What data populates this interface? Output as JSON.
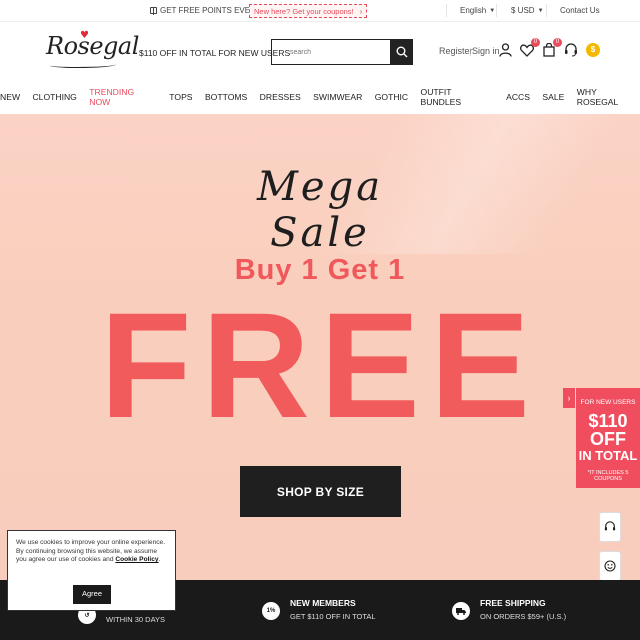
{
  "topbar": {
    "points_text": "GET FREE POINTS EVERYDAY",
    "promo_text": "New here? Get your coupons!",
    "promo_arrow": "›",
    "language": "English",
    "currency": "$ USD",
    "contact": "Contact Us"
  },
  "header": {
    "logo": "Rosegal",
    "tagline": "$110 OFF IN TOTAL FOR NEW USERS",
    "search_placeholder": "search",
    "register": "Register",
    "sign_in": "Sign in",
    "wishlist_count": "0",
    "cart_count": "0",
    "coin_symbol": "$"
  },
  "nav": [
    "NEW",
    "CLOTHING",
    "TRENDING NOW",
    "TOPS",
    "BOTTOMS",
    "DRESSES",
    "SWIMWEAR",
    "GOTHIC",
    "OUTFIT BUNDLES",
    "ACCS",
    "SALE",
    "WHY ROSEGAL"
  ],
  "hero": {
    "script_title": "Mega Sale",
    "subtitle": "Buy 1 Get 1",
    "headline": "FREE",
    "cta": "SHOP BY SIZE"
  },
  "new_user_panel": {
    "tab_arrow": "›",
    "label": "FOR NEW USERS",
    "amount": "$110 OFF",
    "total": "IN TOTAL",
    "note": "*IT INCLUDES 5 COUPONS"
  },
  "cookie": {
    "text": "We use cookies to improve your online experience. By continuing browsing this website, we assume you agree our use of cookies and",
    "link": "Cookie Policy",
    "suffix": ".",
    "button": "Agree"
  },
  "bottom_bar": {
    "item1_line2": "WITHIN 30 DAYS",
    "item2_icon": "1%",
    "item2_line1": "NEW MEMBERS",
    "item2_line2": "GET $110 OFF IN TOTAL",
    "item3_line1": "FREE SHIPPING",
    "item3_line2": "ON ORDERS $59+ (U.S.)"
  },
  "colors": {
    "accent": "#f25b5b",
    "hero_bg": "#f9cebc",
    "dark": "#1a1a1a"
  }
}
